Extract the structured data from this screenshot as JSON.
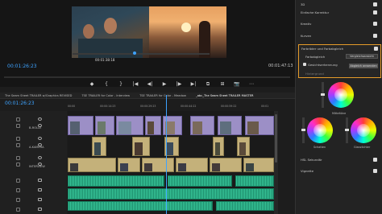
{
  "monitor": {
    "timecode_left": "00:01:26:23",
    "timecode_right": "00:01:47:13",
    "fit_label": "00:01:38:18",
    "transport": [
      "◆",
      "{",
      "}",
      "|◀",
      "◀|",
      "▶",
      "|▶",
      "▶|",
      "⧉",
      "⊞",
      "📷",
      "⋯"
    ]
  },
  "tabs": [
    {
      "label": "The Seam Sheet TRAILER w/Graphics REVISED",
      "active": false
    },
    {
      "label": "TSE TRAILER for Color - Interview",
      "active": false
    },
    {
      "label": "TSE TRAILER for Color - Meadow",
      "active": false
    },
    {
      "label": "_abc_The Seam Sheet TRAILER MASTER",
      "active": true
    }
  ],
  "timeline": {
    "timecode": "00:01:26:23",
    "ruler": [
      "00:00",
      "00:00:14:23",
      "00:00:29:23",
      "00:00:44:22",
      "00:00:59:22",
      "00:01"
    ],
    "tracks": [
      {
        "id": "V6",
        "name": ""
      },
      {
        "id": "V5",
        "name": "B-ROLLE"
      },
      {
        "id": "V4",
        "name": ""
      },
      {
        "id": "V3",
        "name": "A-KAMERA"
      },
      {
        "id": "V2",
        "name": ""
      },
      {
        "id": "V1",
        "name": "INTERVIEW"
      },
      {
        "id": "A1",
        "name": ""
      },
      {
        "id": "A2",
        "name": ""
      },
      {
        "id": "A3",
        "name": ""
      },
      {
        "id": "A4",
        "name": ""
      }
    ]
  },
  "panel": {
    "rows": [
      {
        "label": "3D",
        "checked": true
      },
      {
        "label": "Einfache Korrektur",
        "checked": true
      },
      {
        "label": "Kreativ",
        "checked": true
      },
      {
        "label": "Kurven",
        "checked": true
      },
      {
        "label": "Farbräder und Farbabgleich",
        "checked": true
      }
    ],
    "hsl_title": "Farbabgleich",
    "compare_button": "Vergleichsansicht",
    "face_detect": "Gesichtserkennung",
    "match_button": "Abgleich anwenden",
    "hue_label": "Hintergrund",
    "wheels": {
      "mid": "Mitteltöne",
      "shadows": "Schatten",
      "highlights": "Glanzlichter"
    },
    "bottom_rows": [
      {
        "label": "HSL Sekundär",
        "checked": true
      },
      {
        "label": "Vignette",
        "checked": true
      }
    ]
  }
}
